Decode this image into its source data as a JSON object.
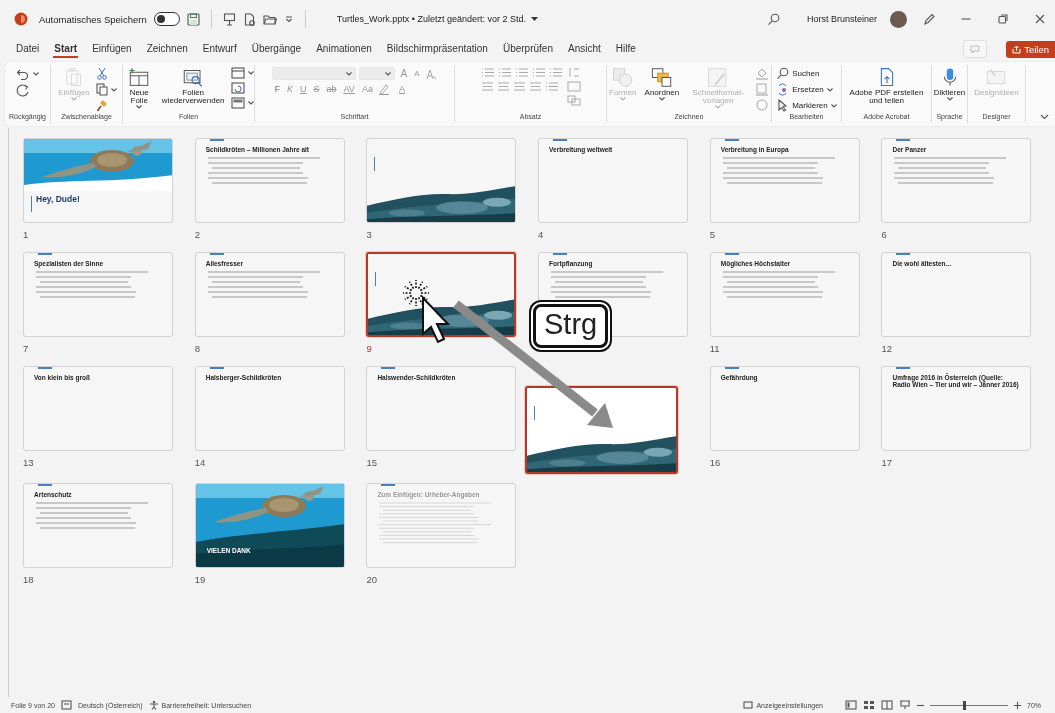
{
  "title_bar": {
    "autosave_label": "Automatisches Speichern",
    "autosave_on": false,
    "file_title": "Turtles_Work.pptx • Zuletzt geändert: vor 2 Std.",
    "user_name": "Horst Brunsteiner"
  },
  "menu_tabs": [
    {
      "label": "Datei",
      "selected": false
    },
    {
      "label": "Start",
      "selected": true
    },
    {
      "label": "Einfügen",
      "selected": false
    },
    {
      "label": "Zeichnen",
      "selected": false
    },
    {
      "label": "Entwurf",
      "selected": false
    },
    {
      "label": "Übergänge",
      "selected": false
    },
    {
      "label": "Animationen",
      "selected": false
    },
    {
      "label": "Bildschirmpräsentation",
      "selected": false
    },
    {
      "label": "Überprüfen",
      "selected": false
    },
    {
      "label": "Ansicht",
      "selected": false
    },
    {
      "label": "Hilfe",
      "selected": false
    }
  ],
  "share_button": "Teilen",
  "ribbon": {
    "groups": [
      {
        "kind": "undo",
        "label": "Rückgängig"
      },
      {
        "kind": "clipboard",
        "label": "Zwischenablage",
        "buttons": [
          {
            "label": "Einfügen",
            "disabled": true
          }
        ]
      },
      {
        "kind": "slides",
        "label": "Folien",
        "buttons": [
          {
            "label": "Neue Folie",
            "disabled": false
          },
          {
            "label": "Folien wiederverwenden",
            "disabled": false
          }
        ]
      },
      {
        "kind": "font",
        "label": "Schriftart",
        "disabled": true,
        "size_buttons": [
          "A",
          "A"
        ],
        "format_buttons": [
          "F",
          "K",
          "U",
          "S",
          "ab",
          "AV",
          "Aa"
        ],
        "color_button": "A"
      },
      {
        "kind": "paragraph",
        "label": "Absatz",
        "disabled": true
      },
      {
        "kind": "drawing",
        "label": "Zeichnen",
        "buttons": [
          {
            "label": "Formen",
            "disabled": true
          },
          {
            "label": "Anordnen",
            "disabled": false
          },
          {
            "label": "Schnellformat-vorlagen",
            "disabled": true
          }
        ]
      },
      {
        "kind": "editing",
        "label": "Bearbeiten",
        "buttons": [
          {
            "label": "Suchen",
            "disabled": false
          },
          {
            "label": "Ersetzen",
            "disabled": false
          },
          {
            "label": "Markieren",
            "disabled": false
          }
        ]
      },
      {
        "kind": "acrobat",
        "label": "Adobe Acrobat",
        "buttons": [
          {
            "label": "Adobe PDF erstellen und teilen",
            "disabled": false
          }
        ]
      },
      {
        "kind": "voice",
        "label": "Sprache",
        "buttons": [
          {
            "label": "Diktieren",
            "disabled": false
          }
        ]
      },
      {
        "kind": "designer",
        "label": "Designer",
        "buttons": [
          {
            "label": "Designideen",
            "disabled": true
          }
        ]
      }
    ]
  },
  "slides": [
    {
      "number": "1",
      "kind": "cover",
      "title": "Hey, Dude!",
      "selected": false
    },
    {
      "number": "2",
      "kind": "bullets",
      "title": "Schildkröten – Millionen Jahre alt",
      "selected": false
    },
    {
      "number": "3",
      "kind": "wave",
      "selected": false
    },
    {
      "number": "4",
      "kind": "title",
      "title": "Verbreitung weltweit",
      "selected": false
    },
    {
      "number": "5",
      "kind": "bullets",
      "title": "Verbreitung in Europa",
      "selected": false
    },
    {
      "number": "6",
      "kind": "bullets",
      "title": "Der Panzer",
      "selected": false
    },
    {
      "number": "7",
      "kind": "bullets",
      "title": "Spezialisten der Sinne",
      "selected": false
    },
    {
      "number": "8",
      "kind": "bullets",
      "title": "Allesfresser",
      "selected": false
    },
    {
      "number": "9",
      "kind": "wave",
      "selected": true
    },
    {
      "kind": "bullets",
      "title": "Fortpflanzung",
      "selected": false
    },
    {
      "number": "11",
      "kind": "bullets",
      "title": "Mögliches Höchstalter",
      "selected": false
    },
    {
      "number": "12",
      "kind": "title",
      "title": "Die wohl ältesten...",
      "selected": false
    },
    {
      "number": "13",
      "kind": "title",
      "title": "Von klein bis groß",
      "selected": false
    },
    {
      "number": "14",
      "kind": "title",
      "title": "Halsberger-Schildkröten",
      "selected": false
    },
    {
      "number": "15",
      "kind": "title",
      "title": "Halswender-Schildkröten",
      "selected": false
    },
    {
      "kind": "wave",
      "selected": true,
      "dragging": true
    },
    {
      "number": "16",
      "kind": "title",
      "title": "Gefährdung",
      "selected": false
    },
    {
      "number": "17",
      "kind": "title",
      "title": "Umfrage 2016 in Österreich (Quelle: Radio Wien – Tier und wir – Jänner 2016)",
      "selected": false
    },
    {
      "number": "18",
      "kind": "bullets",
      "title": "Artenschutz",
      "selected": false
    },
    {
      "number": "19",
      "kind": "closing",
      "title": "VIELEN DANK",
      "selected": false
    },
    {
      "number": "20",
      "kind": "form",
      "title": "Zum Einfügen: Urheber-Angaben",
      "selected": false
    }
  ],
  "annotation": {
    "key": "Strg"
  },
  "status_bar": {
    "slide_info": "Folie 9 von 20",
    "language": "Deutsch (Österreich)",
    "accessibility": "Barrierefreiheit: Untersuchen",
    "display_settings": "Anzeigeeinstellungen",
    "zoom_slider": {
      "level": 0.42
    },
    "zoom": "70%"
  }
}
